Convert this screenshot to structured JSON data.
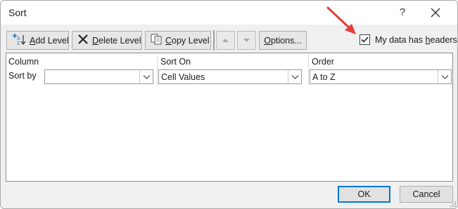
{
  "window": {
    "title": "Sort",
    "help_glyph": "?"
  },
  "toolbar": {
    "add_level": {
      "prefix": "",
      "accel": "A",
      "rest": "dd Level",
      "icon": "add-level-icon"
    },
    "delete_level": {
      "accel": "D",
      "rest": "elete Level",
      "icon": "delete-x-icon"
    },
    "copy_level": {
      "accel": "C",
      "rest": "opy Level",
      "icon": "copy-icon"
    },
    "move_up_icon": "triangle-up-icon",
    "move_down_icon": "triangle-down-icon",
    "options": {
      "accel": "O",
      "rest": "ptions..."
    }
  },
  "headers_option": {
    "checked": true,
    "label_before": "My data has ",
    "label_accel": "h",
    "label_after": "eaders"
  },
  "grid": {
    "columns": [
      "Column",
      "Sort On",
      "Order"
    ],
    "rows": [
      {
        "label": "Sort by",
        "column_value": "",
        "sort_on_value": "Cell Values",
        "order_value": "A to Z"
      }
    ]
  },
  "buttons": {
    "ok": "OK",
    "cancel": "Cancel"
  },
  "colors": {
    "dialog_bg": "#f0f0f0",
    "annotation_arrow": "#e2403a",
    "primary_focus": "#0078d7"
  }
}
